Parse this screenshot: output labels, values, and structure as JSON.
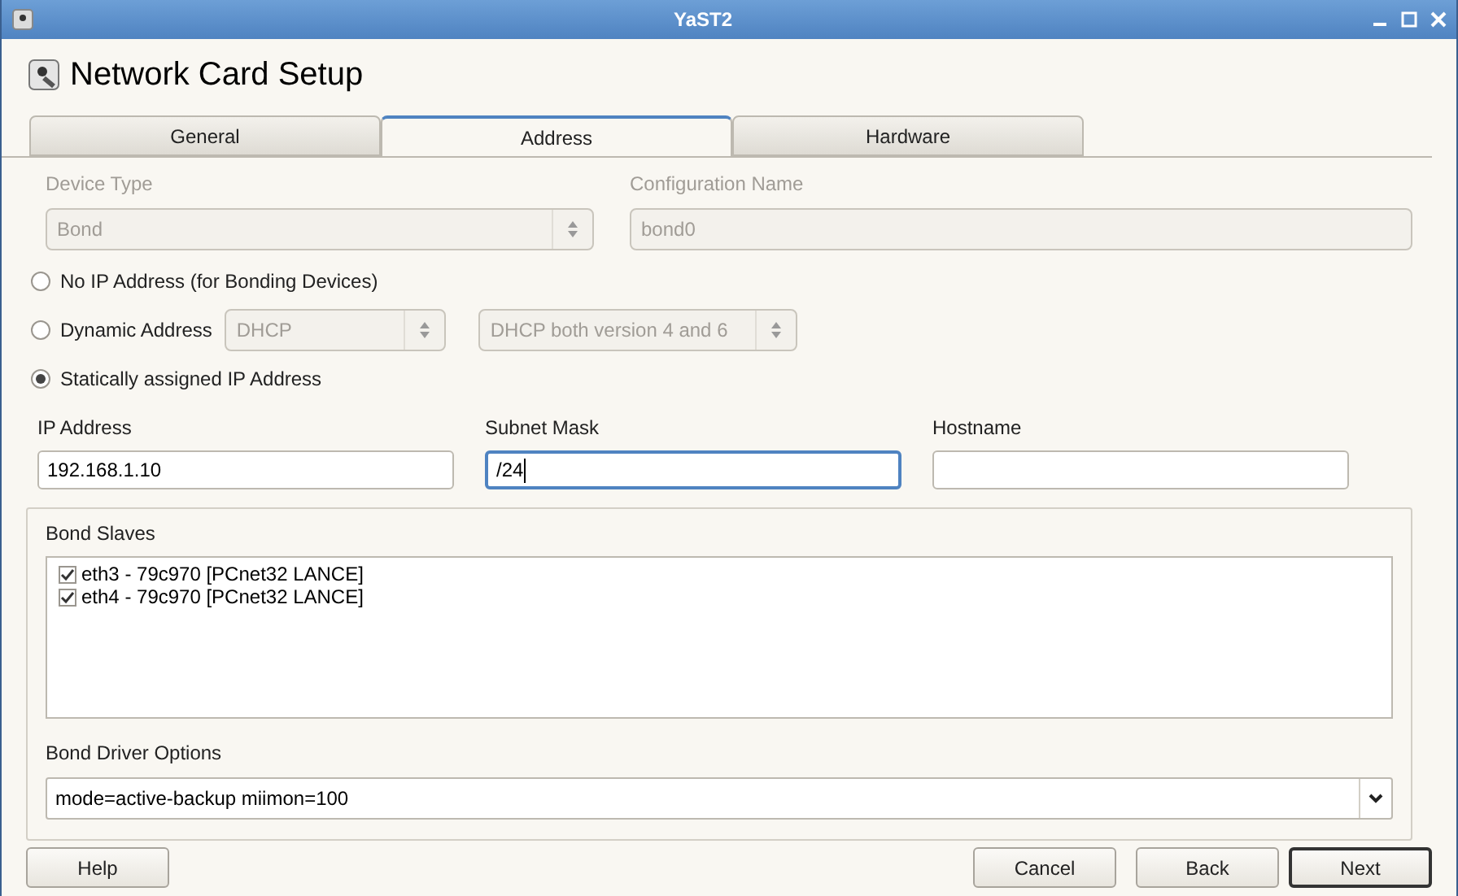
{
  "window": {
    "title": "YaST2"
  },
  "header": {
    "title": "Network Card Setup"
  },
  "tabs": [
    {
      "label": "General",
      "selected": false
    },
    {
      "label": "Address",
      "selected": true
    },
    {
      "label": "Hardware",
      "selected": false
    }
  ],
  "device_type": {
    "label": "Device Type",
    "value": "Bond",
    "disabled": true
  },
  "configuration_name": {
    "label": "Configuration Name",
    "value": "bond0",
    "disabled": true
  },
  "address_modes": [
    {
      "label": "No IP Address (for Bonding Devices)",
      "selected": false
    },
    {
      "label": "Dynamic Address",
      "selected": false,
      "combos": [
        {
          "value": "DHCP",
          "disabled": true
        },
        {
          "value": "DHCP both version 4 and 6",
          "disabled": true
        }
      ]
    },
    {
      "label": "Statically assigned IP Address",
      "selected": true
    }
  ],
  "fields": [
    {
      "label": "IP Address",
      "value": "192.168.1.10",
      "focused": false
    },
    {
      "label": "Subnet Mask",
      "value": "/24",
      "focused": true
    },
    {
      "label": "Hostname",
      "focused": false
    }
  ],
  "bond_slaves": {
    "label": "Bond Slaves",
    "items": [
      {
        "label": "eth3 - 79c970 [PCnet32 LANCE]",
        "checked": true
      },
      {
        "label": "eth4 - 79c970 [PCnet32 LANCE]",
        "checked": true
      }
    ]
  },
  "bond_driver_options": {
    "label": "Bond Driver Options",
    "value": "mode=active-backup miimon=100"
  },
  "buttons": [
    {
      "label": "Help",
      "default": false
    },
    {
      "label": "Cancel",
      "default": false
    },
    {
      "label": "Back",
      "default": false
    },
    {
      "label": "Next",
      "default": true
    }
  ]
}
